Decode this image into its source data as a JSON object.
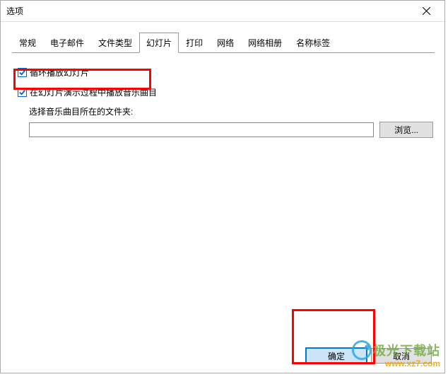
{
  "dialog": {
    "title": "选项"
  },
  "tabs": {
    "items": [
      {
        "label": "常规"
      },
      {
        "label": "电子邮件"
      },
      {
        "label": "文件类型"
      },
      {
        "label": "幻灯片"
      },
      {
        "label": "打印"
      },
      {
        "label": "网络"
      },
      {
        "label": "网络相册"
      },
      {
        "label": "名称标签"
      }
    ],
    "active_index": 3
  },
  "slideshow": {
    "loop_checkbox_label": "循环播放幻灯片",
    "loop_checked": true,
    "music_checkbox_label": "在幻灯片演示过程中播放音乐曲目",
    "music_checked": true,
    "folder_label": "选择音乐曲目所在的文件夹:",
    "folder_value": "",
    "browse_label": "浏览..."
  },
  "buttons": {
    "ok": "确定",
    "cancel": "取消"
  },
  "watermark": {
    "text": "极光下载站",
    "url": "www.xz7.com"
  }
}
